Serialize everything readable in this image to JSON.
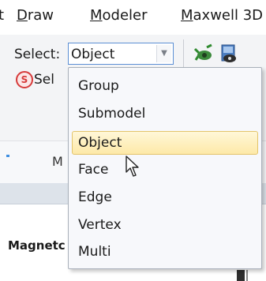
{
  "menubar": {
    "items": [
      {
        "prefix": "",
        "underlined": "",
        "rest": "t"
      },
      {
        "prefix": "",
        "underlined": "D",
        "rest": "raw"
      },
      {
        "prefix": "",
        "underlined": "M",
        "rest": "odeler"
      },
      {
        "prefix": "",
        "underlined": "M",
        "rest": "axwell 3D"
      }
    ]
  },
  "toolbar": {
    "select_label": "Select:",
    "select_value": "Object",
    "combo_arrow_glyph": "▼",
    "select_partial_label": "Sel",
    "tab_partial": "M"
  },
  "dropdown": {
    "options": [
      "Group",
      "Submodel",
      "Object",
      "Face",
      "Edge",
      "Vertex",
      "Multi"
    ],
    "selected": "Object"
  },
  "panel": {
    "partial_title": "Magnetc"
  },
  "icons": {
    "stop_glyph": "S",
    "colors": {
      "accent_blue": "#5b8fd4",
      "highlight_fill": "#fde9a8",
      "highlight_border": "#e3c46b",
      "stop_red": "#d63a3a"
    }
  }
}
